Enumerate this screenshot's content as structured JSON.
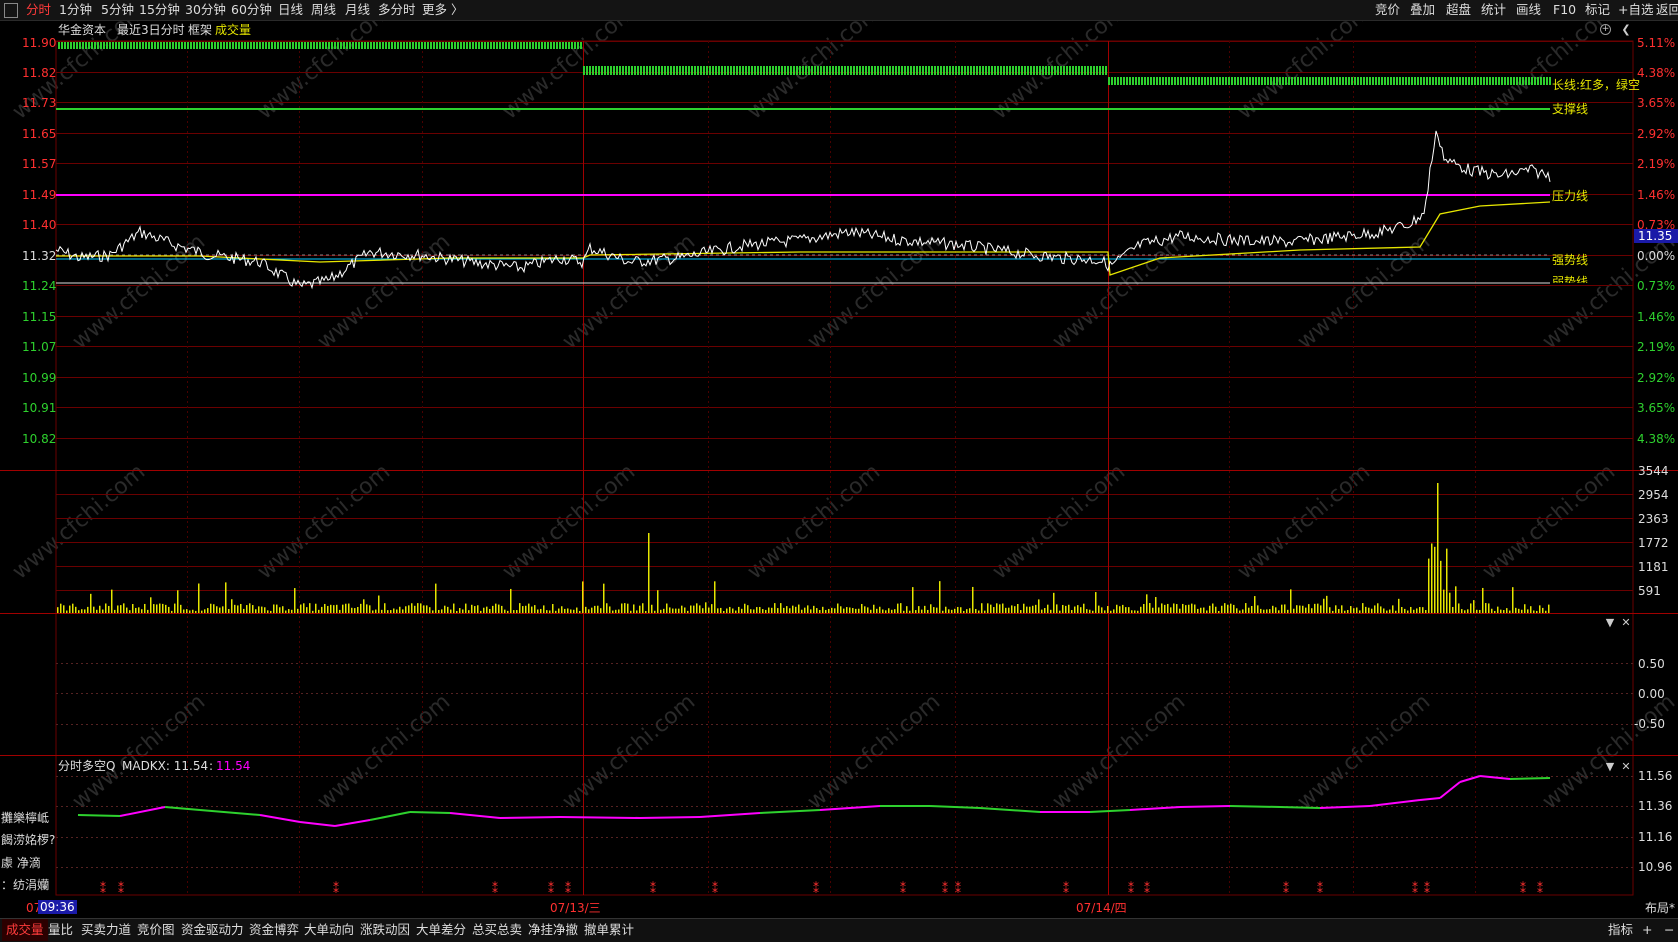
{
  "toolbar": {
    "left": [
      "分时",
      "1分钟",
      "5分钟",
      "15分钟",
      "30分钟",
      "60分钟",
      "日线",
      "周线",
      "月线",
      "多分时",
      "更多 〉"
    ],
    "right": [
      "竞价",
      "叠加",
      "超盘",
      "统计",
      "画线",
      "F10",
      "标记",
      "+自选",
      "返回"
    ]
  },
  "chart_header": {
    "name": "华金资本",
    "range": "最近3日分时",
    "frame": "框架",
    "indicator": "成交量"
  },
  "price_axis": [
    "11.90",
    "11.82",
    "11.73",
    "11.65",
    "11.57",
    "11.49",
    "11.40",
    "11.32",
    "11.24",
    "11.15",
    "11.07",
    "10.99",
    "10.91",
    "10.82"
  ],
  "pct_axis": [
    "5.11%",
    "4.38%",
    "3.65%",
    "2.92%",
    "2.19%",
    "1.46%",
    "0.73%",
    "0.00%",
    "0.73%",
    "1.46%",
    "2.19%",
    "2.92%",
    "3.65%",
    "4.38%"
  ],
  "pct_axis_colors": [
    "#ff3030",
    "#ff3030",
    "#ff3030",
    "#ff3030",
    "#ff3030",
    "#ff3030",
    "#ff3030",
    "#dddddd",
    "#2ed12e",
    "#2ed12e",
    "#2ed12e",
    "#2ed12e",
    "#2ed12e",
    "#2ed12e"
  ],
  "current_price": "11.35",
  "line_labels": {
    "long": "长线:红多，绿空",
    "support": "支撑线",
    "pressure": "压力线",
    "strong": "强势线",
    "weak": "弱势线"
  },
  "volume_axis": [
    "3544",
    "2954",
    "2363",
    "1772",
    "1181",
    "591"
  ],
  "macd_axis": [
    "0.50",
    "0.00",
    "-0.50"
  ],
  "madkx": {
    "title": "分时多空Q",
    "label": "MADKX: 11.54",
    "sep": ":",
    "value": "11.54",
    "axis": [
      "11.56",
      "11.36",
      "11.16",
      "10.96"
    ]
  },
  "left_side_labels": [
    "攤樂檸岻",
    "餲涝姳椤?",
    "豦  净滴",
    "：纺涓孏"
  ],
  "time_labels": {
    "start": "07",
    "cursor": "09:36",
    "day2": "07/13/三",
    "day3": "07/14/四"
  },
  "bottom_tabs": [
    "成交量",
    "量比",
    "买卖力道",
    "竞价图",
    "资金驱动力",
    "资金博弈",
    "大单动向",
    "涨跌动因",
    "大单差分",
    "总买总卖",
    "净挂净撤",
    "撤单累计"
  ],
  "bottom_right": [
    "指标",
    "布局*",
    "+",
    "−"
  ],
  "watermark": "www.cfchi.com",
  "colors": {
    "up": "#ff3030",
    "down": "#2ed12e",
    "price": "#ffffff",
    "avg": "#e6e600",
    "magenta": "#ff00ff",
    "cyan": "#00c8ff",
    "grid": "#6a0000"
  }
}
